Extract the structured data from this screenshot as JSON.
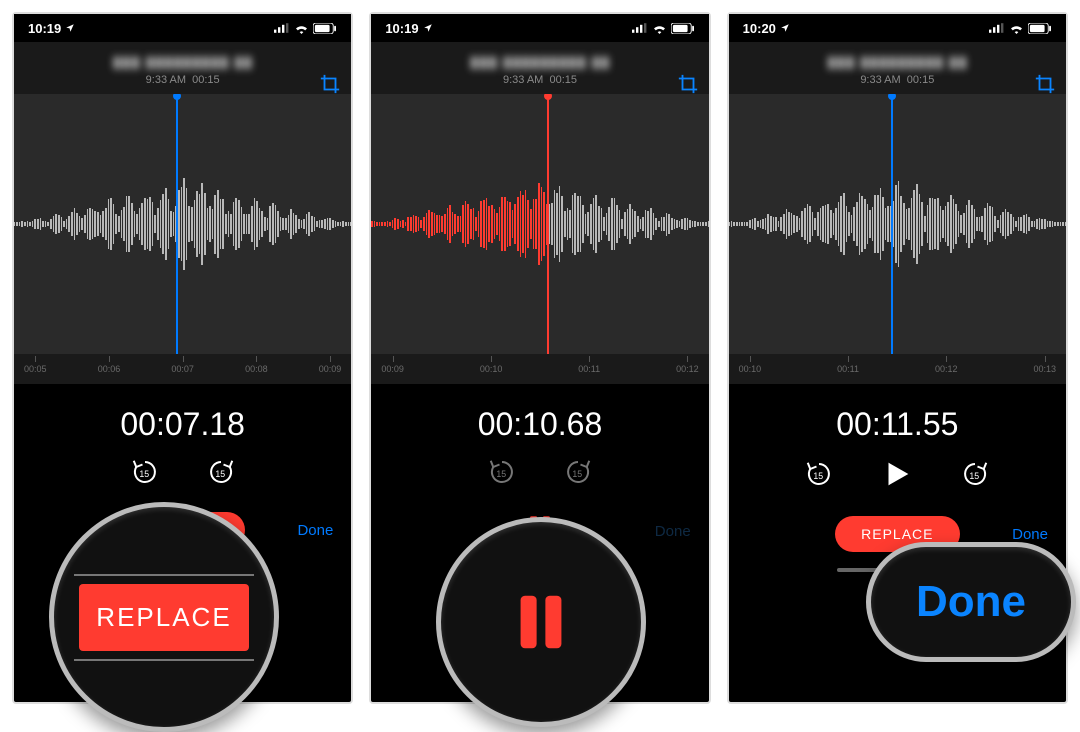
{
  "screens": [
    {
      "status_time": "10:19",
      "title_blurred": "▮▮▮ ▮▮▮▮▮▮▮▮▮ ▮▮",
      "meta_time": "9:33 AM",
      "meta_dur": "00:15",
      "ticks": [
        "00:05",
        "00:06",
        "00:07",
        "00:08",
        "00:09"
      ],
      "big_time": "00:07.18",
      "replace_label": "REPLACE",
      "done_label": "Done",
      "callout_replace": "REPLACE"
    },
    {
      "status_time": "10:19",
      "title_blurred": "▮▮▮ ▮▮▮▮▮▮▮▮▮ ▮▮",
      "meta_time": "9:33 AM",
      "meta_dur": "00:15",
      "ticks": [
        "00:09",
        "00:10",
        "00:11",
        "00:12"
      ],
      "big_time": "00:10.68",
      "done_label": "Done"
    },
    {
      "status_time": "10:20",
      "title_blurred": "▮▮▮ ▮▮▮▮▮▮▮▮▮ ▮▮",
      "meta_time": "9:33 AM",
      "meta_dur": "00:15",
      "ticks": [
        "00:10",
        "00:11",
        "00:12",
        "00:13"
      ],
      "big_time": "00:11.55",
      "replace_label": "REPLACE",
      "done_label": "Done",
      "callout_done": "Done"
    }
  ],
  "colors": {
    "accent_blue": "#007aff",
    "record_red": "#ff3b30"
  }
}
